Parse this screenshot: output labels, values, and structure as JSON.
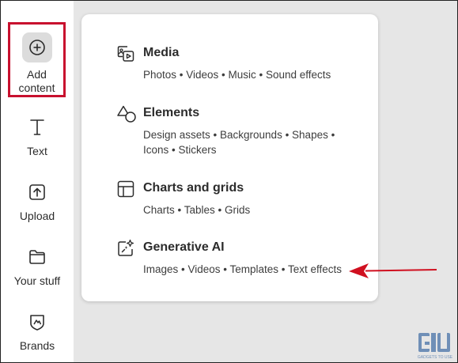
{
  "sidebar": {
    "add_content": "Add content",
    "items": [
      {
        "label": "Text",
        "icon": "text-icon"
      },
      {
        "label": "Upload",
        "icon": "upload-icon"
      },
      {
        "label": "Your stuff",
        "icon": "folder-icon"
      },
      {
        "label": "Brands",
        "icon": "brands-icon"
      }
    ]
  },
  "panel": {
    "sections": [
      {
        "title": "Media",
        "subtitle": "Photos • Videos • Music • Sound effects",
        "icon": "media-icon"
      },
      {
        "title": "Elements",
        "subtitle": "Design assets • Backgrounds • Shapes • Icons • Stickers",
        "icon": "elements-icon"
      },
      {
        "title": "Charts and grids",
        "subtitle": "Charts • Tables • Grids",
        "icon": "grid-icon"
      },
      {
        "title": "Generative AI",
        "subtitle": "Images • Videos • Templates • Text effects",
        "icon": "generative-ai-icon"
      }
    ]
  },
  "annotation": {
    "highlight_color": "#c8102e",
    "arrow_color": "#d01020"
  },
  "watermark": {
    "logo_text": "GU",
    "tagline": "GADGETS TO USE"
  }
}
